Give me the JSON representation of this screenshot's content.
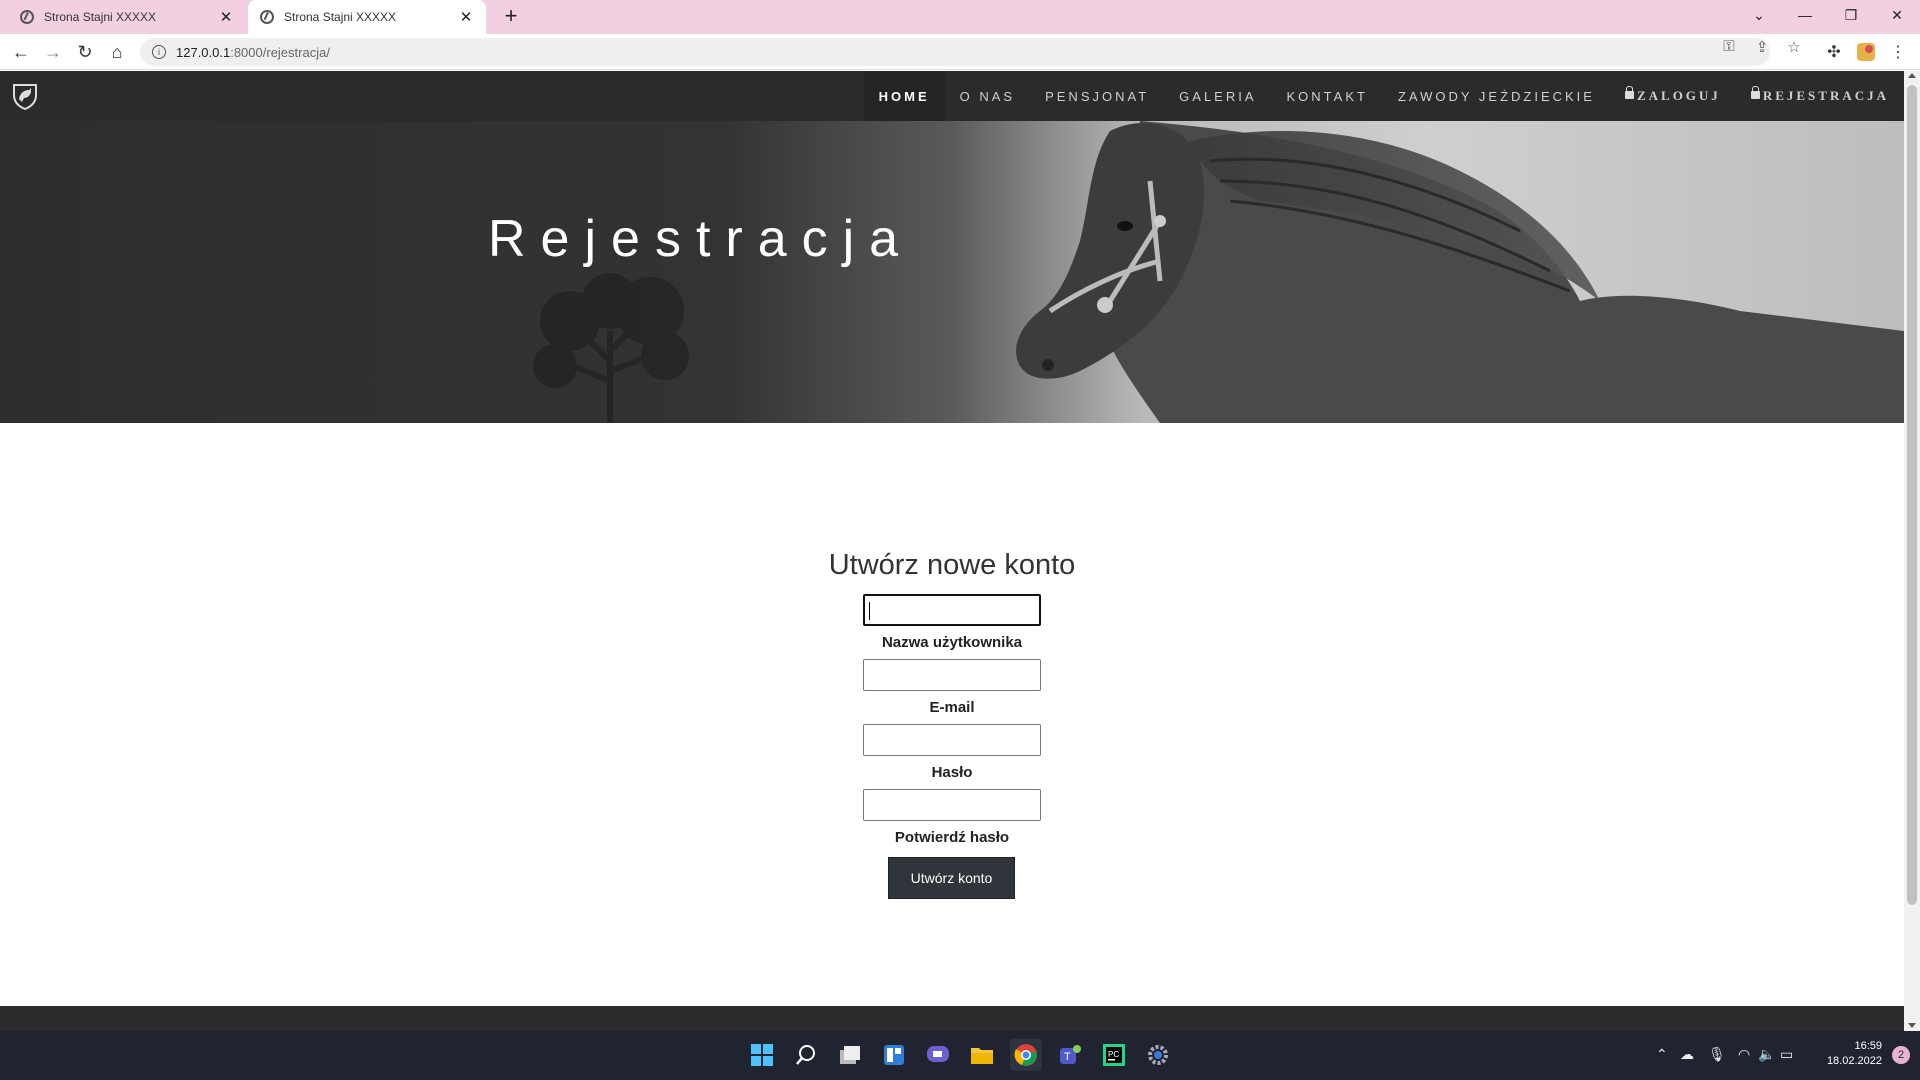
{
  "browser": {
    "tabs": [
      {
        "title": "Strona Stajni XXXXX",
        "active": false
      },
      {
        "title": "Strona Stajni XXXXX",
        "active": true
      }
    ],
    "url_host": "127.0.0.1",
    "url_rest": ":8000/rejestracja/"
  },
  "site": {
    "menu": [
      {
        "label": "HOME",
        "active": true
      },
      {
        "label": "O NAS"
      },
      {
        "label": "PENSJONAT"
      },
      {
        "label": "GALERIA"
      },
      {
        "label": "KONTAKT"
      },
      {
        "label": "ZAWODY JEŹDZIECKIE"
      },
      {
        "label": "ZALOGUJ",
        "icon": "lock-icon"
      },
      {
        "label": "REJESTRACJA",
        "icon": "lock-icon"
      }
    ],
    "hero_title": "Rejestracja"
  },
  "form": {
    "title": "Utwórz nowe konto",
    "fields": [
      {
        "label": "Nazwa użytkownika",
        "value": ""
      },
      {
        "label": "E-mail",
        "value": ""
      },
      {
        "label": "Hasło",
        "value": ""
      },
      {
        "label": "Potwierdź hasło",
        "value": ""
      }
    ],
    "submit_label": "Utwórz konto"
  },
  "taskbar": {
    "time": "16:59",
    "date": "18.02.2022",
    "notifications": "2"
  },
  "colors": {
    "tabbar": "#f2cfe1",
    "nav": "#2b2b2b",
    "button": "#2f353a",
    "taskbar": "#1f2430"
  }
}
